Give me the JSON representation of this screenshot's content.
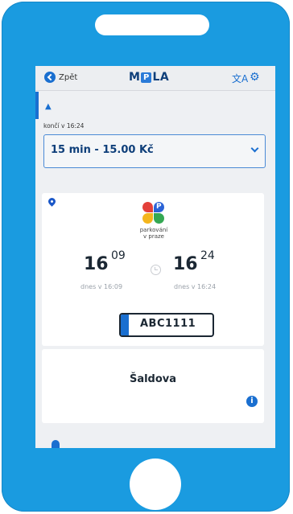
{
  "theme": {
    "frame_color": "#1a9be0",
    "accent": "#1a6fd0",
    "dark_text": "#1b2733"
  },
  "header": {
    "back_label": "Zpět",
    "logo_left": "M",
    "logo_p": "P",
    "logo_right": "LA",
    "translate_glyph": "文A",
    "settings_glyph": "⚙"
  },
  "notice": {
    "ends_label": "končí v 16:24"
  },
  "duration_select": {
    "selected": "15 min - 15.00 Kč"
  },
  "parking": {
    "provider_line1": "parkování",
    "provider_line2": "v praze",
    "start": {
      "hour": "16",
      "minute": "09",
      "label": "dnes v 16:09"
    },
    "end": {
      "hour": "16",
      "minute": "24",
      "label": "dnes v 16:24"
    },
    "plate": "ABC1111"
  },
  "zone": {
    "street": "Šaldova",
    "info_glyph": "i"
  }
}
